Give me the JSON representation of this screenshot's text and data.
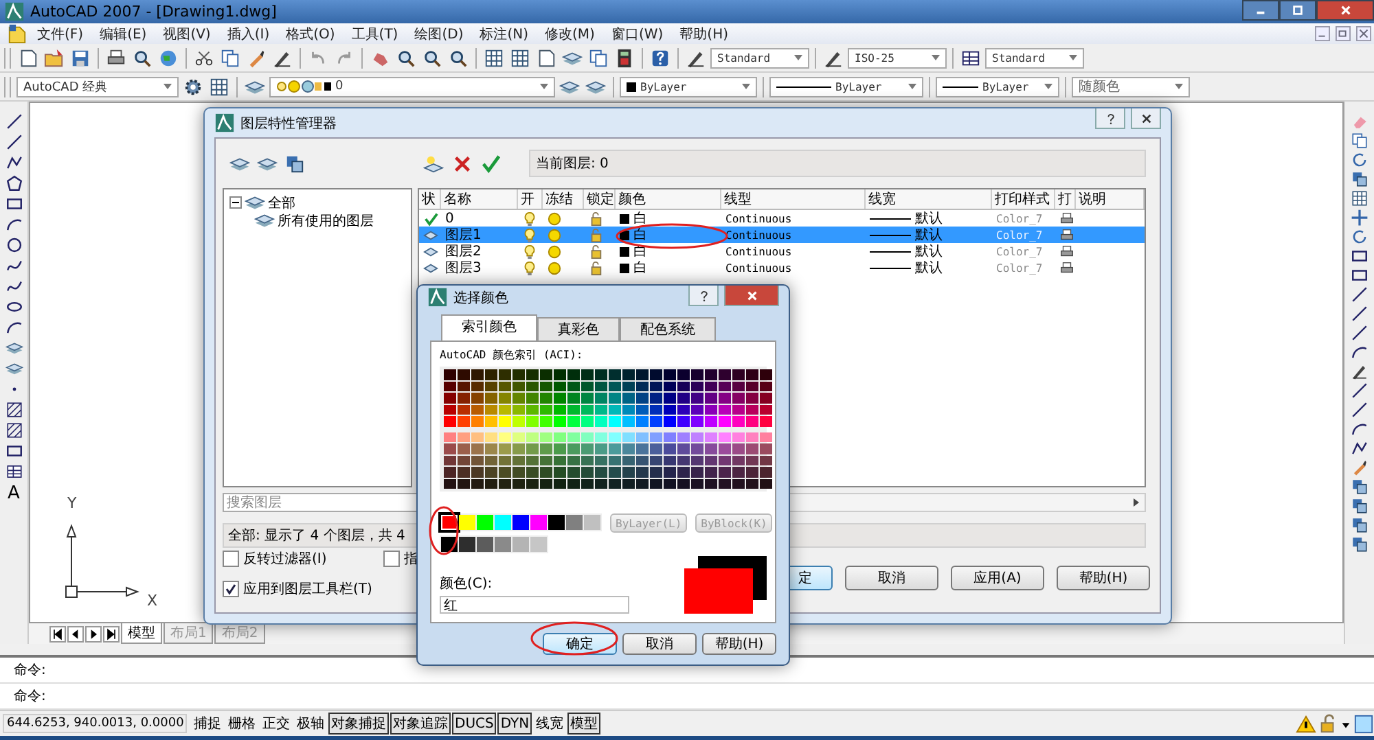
{
  "window": {
    "title": "AutoCAD 2007 - [Drawing1.dwg]"
  },
  "menu": [
    "文件(F)",
    "编辑(E)",
    "视图(V)",
    "插入(I)",
    "格式(O)",
    "工具(T)",
    "绘图(D)",
    "标注(N)",
    "修改(M)",
    "窗口(W)",
    "帮助(H)"
  ],
  "styles_toolbar": {
    "text_style": "Standard",
    "dim_style": "ISO-25",
    "table_style": "Standard"
  },
  "workspace": "AutoCAD 经典",
  "layer_combo": "0",
  "properties_toolbar": {
    "color_setting": "ByLayer",
    "linetype": "ByLayer",
    "lineweight": "ByLayer",
    "plot_style": "随颜色"
  },
  "draw_toolbar": {
    "text_tool": "A"
  },
  "drawing": {
    "axis_x": "X",
    "axis_y": "Y"
  },
  "layout_tabs": [
    {
      "label": "模型",
      "selected": true
    },
    {
      "label": "布局1",
      "selected": false
    },
    {
      "label": "布局2",
      "selected": false
    }
  ],
  "command_lines": [
    "命令:",
    "命令:"
  ],
  "status_bar": {
    "coordinates": "644.6253,  940.0013,  0.0000",
    "toggles": [
      {
        "label": "捕捉",
        "on": false
      },
      {
        "label": "栅格",
        "on": false
      },
      {
        "label": "正交",
        "on": false
      },
      {
        "label": "极轴",
        "on": false
      },
      {
        "label": "对象捕捉",
        "on": true
      },
      {
        "label": "对象追踪",
        "on": true
      },
      {
        "label": "DUCS",
        "on": true
      },
      {
        "label": "DYN",
        "on": true
      },
      {
        "label": "线宽",
        "on": false
      },
      {
        "label": "模型",
        "on": true
      }
    ]
  },
  "layer_dialog": {
    "title": "图层特性管理器",
    "current_layer": "当前图层: 0",
    "tree": [
      {
        "label": "全部",
        "expanded": true,
        "children": [
          {
            "label": "所有使用的图层"
          }
        ]
      }
    ],
    "columns": [
      "状",
      "名称",
      "开",
      "冻结",
      "锁定",
      "颜色",
      "线型",
      "线宽",
      "打印样式",
      "打",
      "说明"
    ],
    "rows": [
      {
        "kind": "current",
        "name": "0",
        "color_name": "白",
        "linetype": "Continuous",
        "lineweight": "默认",
        "plot_style": "Color_7",
        "selected": false
      },
      {
        "kind": "layer",
        "name": "图层1",
        "color_name": "白",
        "linetype": "Continuous",
        "lineweight": "默认",
        "plot_style": "Color_7",
        "selected": true
      },
      {
        "kind": "layer",
        "name": "图层2",
        "color_name": "白",
        "linetype": "Continuous",
        "lineweight": "默认",
        "plot_style": "Color_7",
        "selected": false
      },
      {
        "kind": "layer",
        "name": "图层3",
        "color_name": "白",
        "linetype": "Continuous",
        "lineweight": "默认",
        "plot_style": "Color_7",
        "selected": false
      }
    ],
    "search": {
      "placeholder": "搜索图层"
    },
    "summary": "全部: 显示了 4 个图层，共 4",
    "checkboxes": [
      {
        "label": "反转过滤器(I)",
        "checked": false
      },
      {
        "label": "指",
        "checked": false
      },
      {
        "label": "应用到图层工具栏(T)",
        "checked": true
      }
    ],
    "buttons": [
      {
        "label": "定",
        "focused": true
      },
      {
        "label": "取消",
        "focused": false
      },
      {
        "label": "应用(A)",
        "focused": false
      },
      {
        "label": "帮助(H)",
        "focused": false
      }
    ]
  },
  "color_dialog": {
    "title": "选择颜色",
    "tabs": [
      {
        "label": "索引颜色",
        "selected": true
      },
      {
        "label": "真彩色",
        "selected": false
      },
      {
        "label": "配色系统",
        "selected": false
      }
    ],
    "aci_label": "AutoCAD 颜色索引 (ACI):",
    "standard_colors": [
      {
        "color": "#ff0000",
        "selected": true
      },
      {
        "color": "#ffff00",
        "selected": false
      },
      {
        "color": "#00ff00",
        "selected": false
      },
      {
        "color": "#00ffff",
        "selected": false
      },
      {
        "color": "#0000ff",
        "selected": false
      },
      {
        "color": "#ff00ff",
        "selected": false
      },
      {
        "color": "#000000",
        "selected": false
      },
      {
        "color": "#808080",
        "selected": false
      },
      {
        "color": "#c0c0c0",
        "selected": false
      }
    ],
    "gray_colors": [
      {
        "color": "#000000",
        "selected": false
      },
      {
        "color": "#2e2e2e",
        "selected": false
      },
      {
        "color": "#5c5c5c",
        "selected": false
      },
      {
        "color": "#8a8a8a",
        "selected": false
      },
      {
        "color": "#b4b4b4",
        "selected": false
      },
      {
        "color": "#c6c6c6",
        "selected": false
      }
    ],
    "bylayer_button": {
      "label": "ByLayer(L)",
      "disabled": true
    },
    "byblock_button": {
      "label": "ByBlock(K)",
      "disabled": true
    },
    "color_label": "颜色(C):",
    "color_value": "红",
    "buttons": [
      {
        "label": "确定",
        "focused": true
      },
      {
        "label": "取消",
        "focused": false
      },
      {
        "label": "帮助(H)",
        "focused": false
      }
    ]
  }
}
